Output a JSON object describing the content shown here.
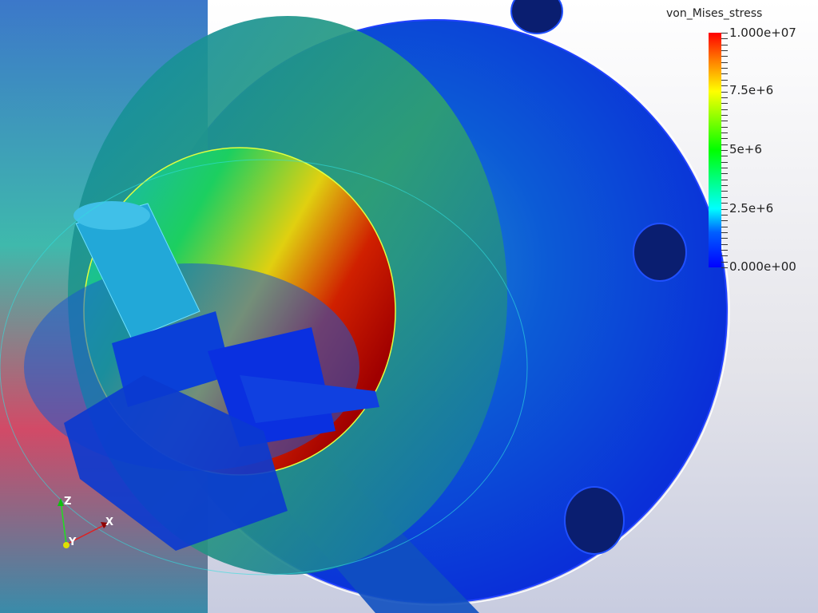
{
  "colorbar": {
    "title": "von_Mises_stress",
    "labels": [
      "1.000e+07",
      "7.5e+6",
      "5e+6",
      "2.5e+6",
      "0.000e+00"
    ],
    "range": [
      0,
      10000000
    ],
    "colors": [
      "#0000ff",
      "#00ffff",
      "#00ff00",
      "#ffff00",
      "#ff0000"
    ]
  },
  "axes": {
    "x": "X",
    "y": "Y",
    "z": "Z"
  }
}
